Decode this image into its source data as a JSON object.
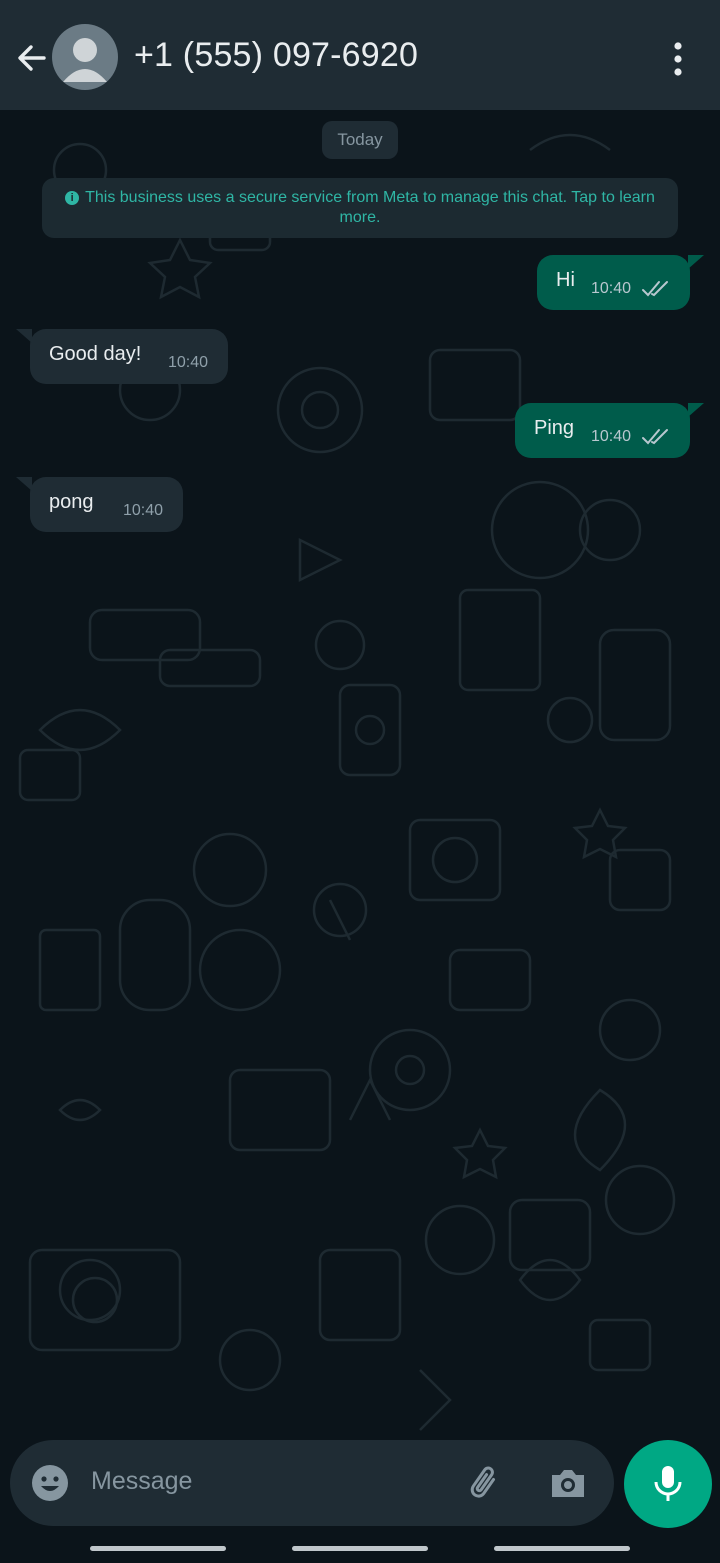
{
  "header": {
    "title": "+1 (555) 097-6920",
    "back_icon": "arrow-left-icon",
    "menu_icon": "kebab-menu-icon"
  },
  "chat": {
    "date_label": "Today",
    "info_banner": "This business uses a secure service from Meta to manage this chat. Tap to learn more.",
    "messages": [
      {
        "direction": "outgoing",
        "text": "Hi",
        "time": "10:40",
        "status": "read"
      },
      {
        "direction": "incoming",
        "text": "Good day!",
        "time": "10:40"
      },
      {
        "direction": "outgoing",
        "text": "Ping",
        "time": "10:40",
        "status": "read"
      },
      {
        "direction": "incoming",
        "text": "pong",
        "time": "10:40"
      }
    ]
  },
  "composer": {
    "placeholder": "Message",
    "emoji_icon": "emoji-icon",
    "attach_icon": "paperclip-icon",
    "camera_icon": "camera-icon",
    "mic_icon": "microphone-icon"
  },
  "colors": {
    "background": "#0b141a",
    "header": "#1f2c34",
    "outgoing_bubble": "#005c4b",
    "incoming_bubble": "#1f2c34",
    "accent": "#00a884"
  }
}
